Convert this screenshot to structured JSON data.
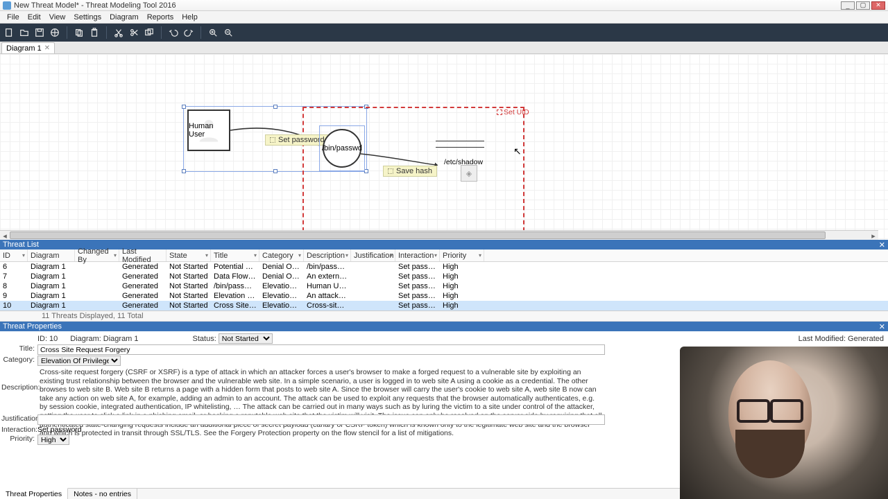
{
  "window": {
    "title": "New Threat Model* - Threat Modeling Tool 2016"
  },
  "menu": {
    "items": [
      "File",
      "Edit",
      "View",
      "Settings",
      "Diagram",
      "Reports",
      "Help"
    ]
  },
  "tabs": {
    "active": "Diagram 1"
  },
  "diagram": {
    "entity_human": "Human User",
    "process_passwd": "/bin/passwd",
    "store_shadow": "/etc/shadow",
    "flow_setpwd": "Set password",
    "flow_savehash": "Save hash",
    "trust_label": "Set UID"
  },
  "threatlist": {
    "title": "Threat List",
    "columns": [
      "ID",
      "Diagram",
      "Changed By",
      "Last Modified",
      "State",
      "Title",
      "Category",
      "Description",
      "Justification",
      "Interaction",
      "Priority"
    ],
    "rows": [
      {
        "id": "6",
        "diagram": "Diagram 1",
        "changed": "",
        "modified": "Generated",
        "state": "Not Started",
        "title": "Potential Proc...",
        "category": "Denial Of Servi...",
        "desc": "/bin/passwd cr...",
        "just": "",
        "interaction": "Set password",
        "priority": "High"
      },
      {
        "id": "7",
        "diagram": "Diagram 1",
        "changed": "",
        "modified": "Generated",
        "state": "Not Started",
        "title": "Data Flow Set...",
        "category": "Denial Of Servi...",
        "desc": "An external ag...",
        "just": "",
        "interaction": "Set password",
        "priority": "High"
      },
      {
        "id": "8",
        "diagram": "Diagram 1",
        "changed": "",
        "modified": "Generated",
        "state": "Not Started",
        "title": "/bin/passwd...",
        "category": "Elevation Of Pr...",
        "desc": "Human User...",
        "just": "",
        "interaction": "Set password",
        "priority": "High"
      },
      {
        "id": "9",
        "diagram": "Diagram 1",
        "changed": "",
        "modified": "Generated",
        "state": "Not Started",
        "title": "Elevation by C...",
        "category": "Elevation Of Pr...",
        "desc": "An attacker m...",
        "just": "",
        "interaction": "Set password",
        "priority": "High"
      },
      {
        "id": "10",
        "diagram": "Diagram 1",
        "changed": "",
        "modified": "Generated",
        "state": "Not Started",
        "title": "Cross Site Req...",
        "category": "Elevation Of Pr...",
        "desc": "Cross-site requ...",
        "just": "",
        "interaction": "Set password",
        "priority": "High"
      }
    ],
    "status": "11 Threats Displayed, 11 Total"
  },
  "props": {
    "panel_title": "Threat Properties",
    "id_label": "ID:",
    "id": "10",
    "diagram_label": "Diagram:",
    "diagram": "Diagram 1",
    "status_label": "Status:",
    "status": "Not Started",
    "lastmod_label": "Last Modified:",
    "lastmod": "Generated",
    "title_label": "Title:",
    "title": "Cross Site Request Forgery",
    "category_label": "Category:",
    "category": "Elevation Of Privilege",
    "description_label": "Description:",
    "description": "Cross-site request forgery (CSRF or XSRF) is a type of attack in which an attacker forces a user's browser to make a forged request to a vulnerable site by exploiting an existing trust relationship between the browser and the vulnerable web site.  In a simple scenario, a user is logged in to web site A using a cookie as a credential.  The other browses to web site B.  Web site B returns a page with a hidden form that posts to web site A.  Since the browser will carry the user's cookie to web site A, web site B now can take any action on web site A, for example, adding an admin to an account.  The attack can be used to exploit any requests that the browser automatically authenticates, e.g. by session cookie, integrated authentication, IP whitelisting, …  The attack can be carried out in many ways such as by luring the victim to a site under control of the attacker, getting the user to click a link in a phishing email, or hacking a reputable web site that the victim will visit. The issue can only be resolved on the server side by requiring that all authenticated state-changing requests include an additional piece of secret payload (canary or CSRF token) which is known only to the legitimate web site and the browser and which is protected in transit through SSL/TLS. See the Forgery Protection property on the flow stencil for a list of mitigations.",
    "justification_label": "Justification:",
    "justification": "",
    "interaction_label": "Interaction:",
    "interaction": "Set password",
    "priority_label": "Priority:",
    "priority": "High",
    "tabs": {
      "active": "Threat Properties",
      "other": "Notes - no entries"
    }
  }
}
